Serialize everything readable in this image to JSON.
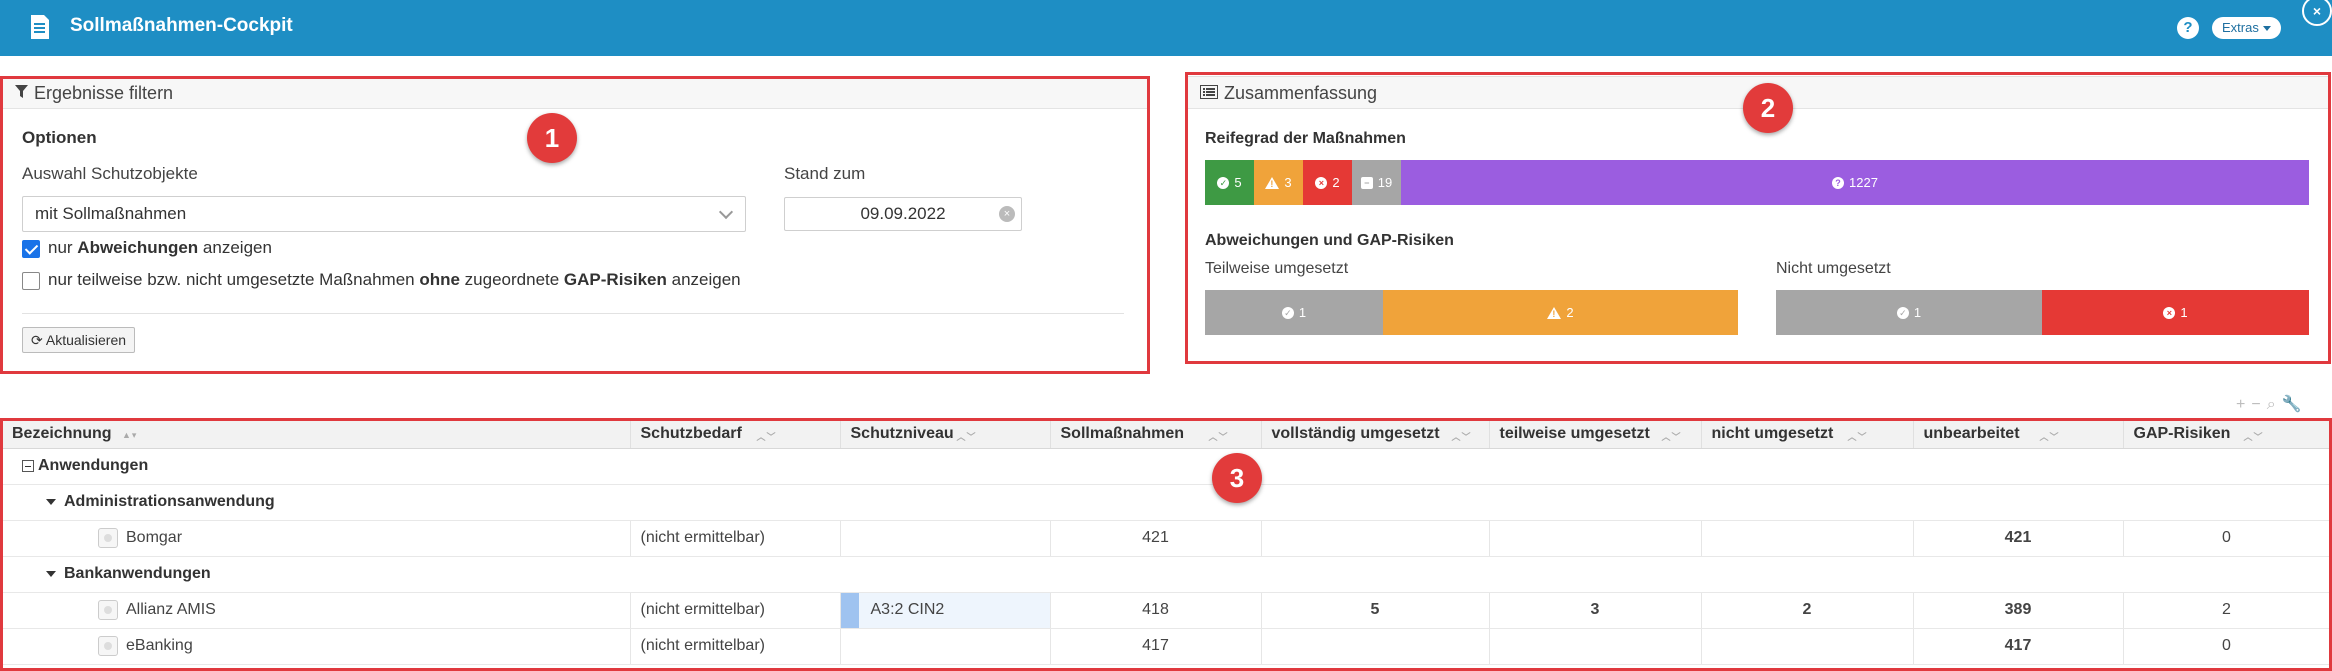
{
  "app": {
    "title": "Sollmaßnahmen-Cockpit",
    "help_label": "?",
    "extras_label": "Extras",
    "close_label": "×"
  },
  "filter": {
    "header": "Ergebnisse filtern",
    "options_label": "Optionen",
    "auswahl_label": "Auswahl Schutzobjekte",
    "auswahl_value": "mit Sollmaßnahmen",
    "stand_label": "Stand zum",
    "stand_value": "09.09.2022",
    "cb1_pre": "nur ",
    "cb1_bold": "Abweichungen",
    "cb1_post": " anzeigen",
    "cb1_checked": true,
    "cb2_pre": "nur teilweise bzw. nicht umgesetzte Maßnahmen ",
    "cb2_bold1": "ohne",
    "cb2_mid": " zugeordnete ",
    "cb2_bold2": "GAP-Risiken",
    "cb2_post": " anzeigen",
    "cb2_checked": false,
    "refresh_label": "Aktualisieren"
  },
  "summary": {
    "header": "Zusammenfassung",
    "reifegrad_label": "Reifegrad der Maßnahmen",
    "reifegrad": [
      {
        "value": 5,
        "icon": "check-icon",
        "color": "#3e9a44"
      },
      {
        "value": 3,
        "icon": "warning-icon",
        "color": "#f0a33a"
      },
      {
        "value": 2,
        "icon": "times-icon",
        "color": "#e53935"
      },
      {
        "value": 19,
        "icon": "minus-icon",
        "color": "#a6a6a6"
      },
      {
        "value": 1227,
        "icon": "question-icon",
        "color": "#9b5de0"
      }
    ],
    "abw_label": "Abweichungen und GAP-Risiken",
    "teilweise_label": "Teilweise umgesetzt",
    "teilweise": [
      {
        "value": 1,
        "icon": "check-icon",
        "color": "#a6a6a6"
      },
      {
        "value": 2,
        "icon": "warning-icon",
        "color": "#f0a33a"
      }
    ],
    "nicht_label": "Nicht umgesetzt",
    "nicht": [
      {
        "value": 1,
        "icon": "check-icon",
        "color": "#a6a6a6"
      },
      {
        "value": 1,
        "icon": "times-icon",
        "color": "#e53935"
      }
    ]
  },
  "badges": {
    "one": "1",
    "two": "2",
    "three": "3"
  },
  "table": {
    "columns": [
      "Bezeichnung",
      "Schutzbedarf",
      "Schutzniveau",
      "Sollmaßnahmen",
      "vollständig umgesetzt",
      "teilweise umgesetzt",
      "nicht umgesetzt",
      "unbearbeitet",
      "GAP-Risiken"
    ],
    "group_root": "Anwendungen",
    "group_admin": "Administrationsanwendung",
    "group_bank": "Bankanwendungen",
    "rows": [
      {
        "name": "Bomgar",
        "schutzbedarf": "(nicht ermittelbar)",
        "schutzniveau": "",
        "soll": "421",
        "voll": "",
        "teil": "",
        "nicht": "",
        "unbearbeitet": "421",
        "gap": "0"
      },
      {
        "name": "Allianz AMIS",
        "schutzbedarf": "(nicht ermittelbar)",
        "schutzniveau": "A3:2 CIN2",
        "soll": "418",
        "voll": "5",
        "teil": "3",
        "nicht": "2",
        "unbearbeitet": "389",
        "gap": "2"
      },
      {
        "name": "eBanking",
        "schutzbedarf": "(nicht ermittelbar)",
        "schutzniveau": "",
        "soll": "417",
        "voll": "",
        "teil": "",
        "nicht": "",
        "unbearbeitet": "417",
        "gap": "0"
      }
    ]
  }
}
